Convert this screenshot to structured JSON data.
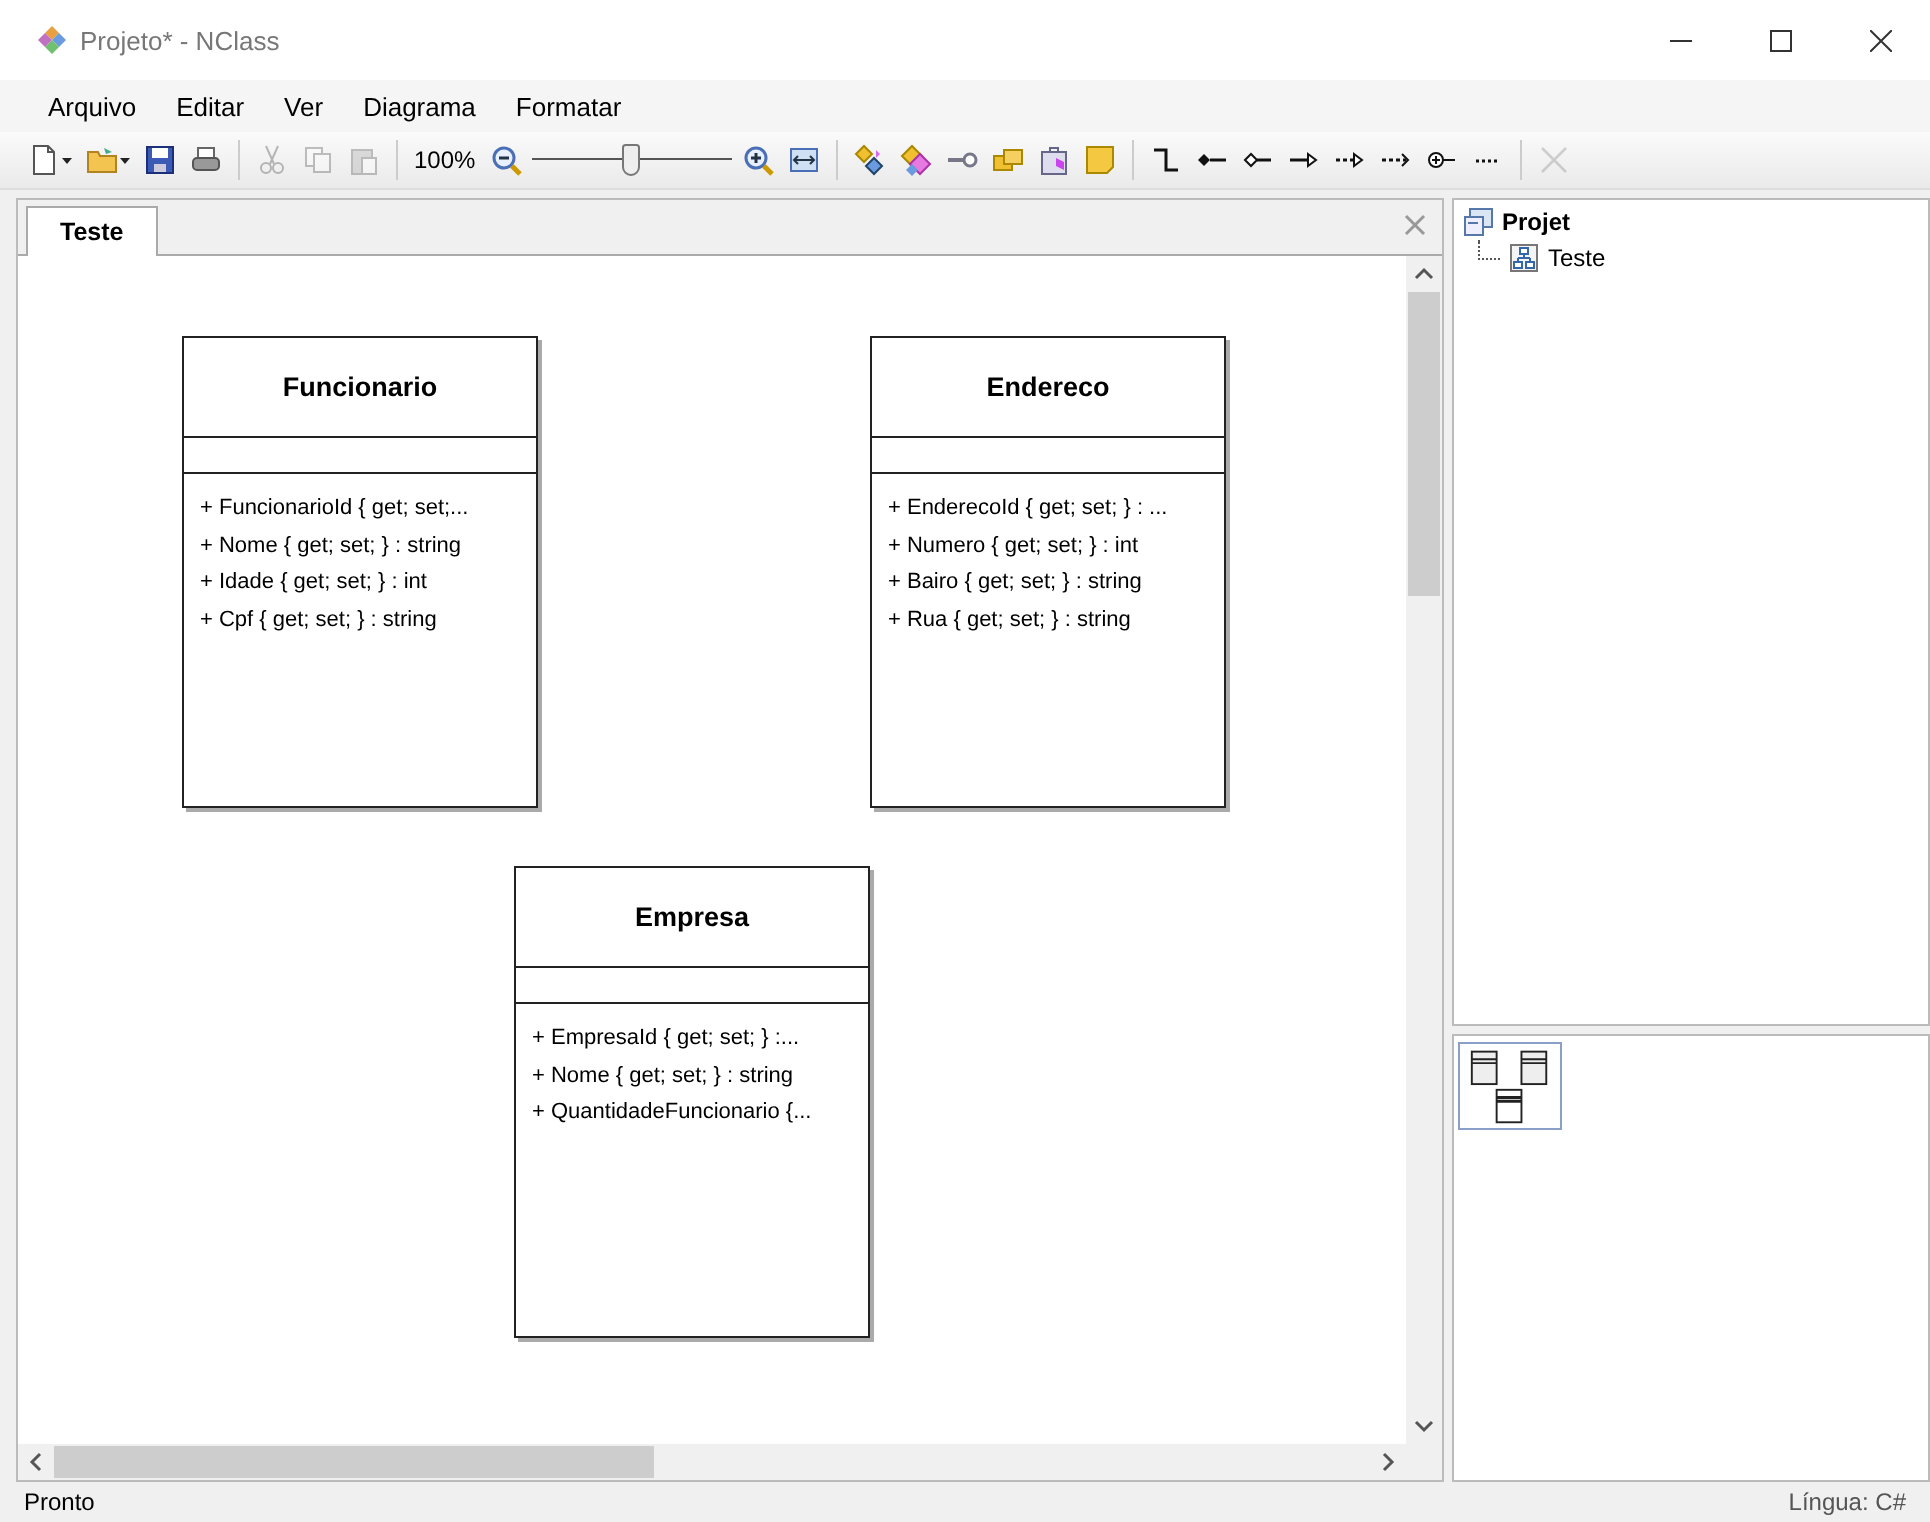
{
  "window": {
    "title": "Projeto* - NClass"
  },
  "menu": [
    "Arquivo",
    "Editar",
    "Ver",
    "Diagrama",
    "Formatar"
  ],
  "toolbar": [
    {
      "kind": "new",
      "disabled": false
    },
    {
      "kind": "open",
      "disabled": false
    },
    {
      "kind": "save",
      "disabled": false
    },
    {
      "kind": "print",
      "disabled": false
    },
    {
      "kind": "separator"
    },
    {
      "kind": "cut",
      "disabled": true
    },
    {
      "kind": "copy",
      "disabled": true
    },
    {
      "kind": "paste",
      "disabled": true
    },
    {
      "kind": "separator"
    },
    {
      "kind": "reading",
      "text": "100%"
    },
    {
      "kind": "zoomout",
      "disabled": false
    },
    {
      "kind": "slider",
      "level": 0.5
    },
    {
      "kind": "zoomin",
      "disabled": false
    },
    {
      "kind": "fit",
      "disabled": false
    },
    {
      "kind": "separator"
    },
    {
      "kind": "classes",
      "disabled": false
    },
    {
      "kind": "shapes",
      "disabled": false
    },
    {
      "kind": "lollipop",
      "disabled": false
    },
    {
      "kind": "folders",
      "disabled": false
    },
    {
      "kind": "package",
      "disabled": false
    },
    {
      "kind": "note",
      "disabled": false
    },
    {
      "kind": "separator"
    },
    {
      "kind": "elbow",
      "disabled": false
    },
    {
      "kind": "composition",
      "disabled": false
    },
    {
      "kind": "aggregation",
      "disabled": false
    },
    {
      "kind": "association",
      "disabled": false
    },
    {
      "kind": "realization",
      "disabled": false
    },
    {
      "kind": "dependency",
      "disabled": false
    },
    {
      "kind": "nesting",
      "disabled": false
    },
    {
      "kind": "dotted",
      "disabled": false
    },
    {
      "kind": "separator"
    },
    {
      "kind": "delete",
      "disabled": true
    }
  ],
  "tabs": [
    {
      "label": "Teste",
      "selected": true
    }
  ],
  "classes": [
    {
      "name": "Funcionario",
      "members": [
        "+ FuncionarioId { get; set;...",
        "+ Nome { get; set; } : string",
        "+ Idade { get; set; } : int",
        "+ Cpf { get; set; } : string"
      ]
    },
    {
      "name": "Endereco",
      "members": [
        "+ EnderecoId { get; set; } : ...",
        "+ Numero { get; set; } : int",
        "+ Bairo { get; set; } : string",
        "+ Rua { get; set; } : string"
      ]
    },
    {
      "name": "Empresa",
      "members": [
        "+ EmpresaId { get; set; } :...",
        "+ Nome { get; set; } : string",
        "+ QuantidadeFuncionario {..."
      ]
    }
  ],
  "tree": [
    {
      "label": "Projet",
      "children": [
        {
          "label": "Teste"
        }
      ]
    }
  ],
  "status_bar": {
    "text": "Pronto",
    "language": "Língua: C#"
  }
}
